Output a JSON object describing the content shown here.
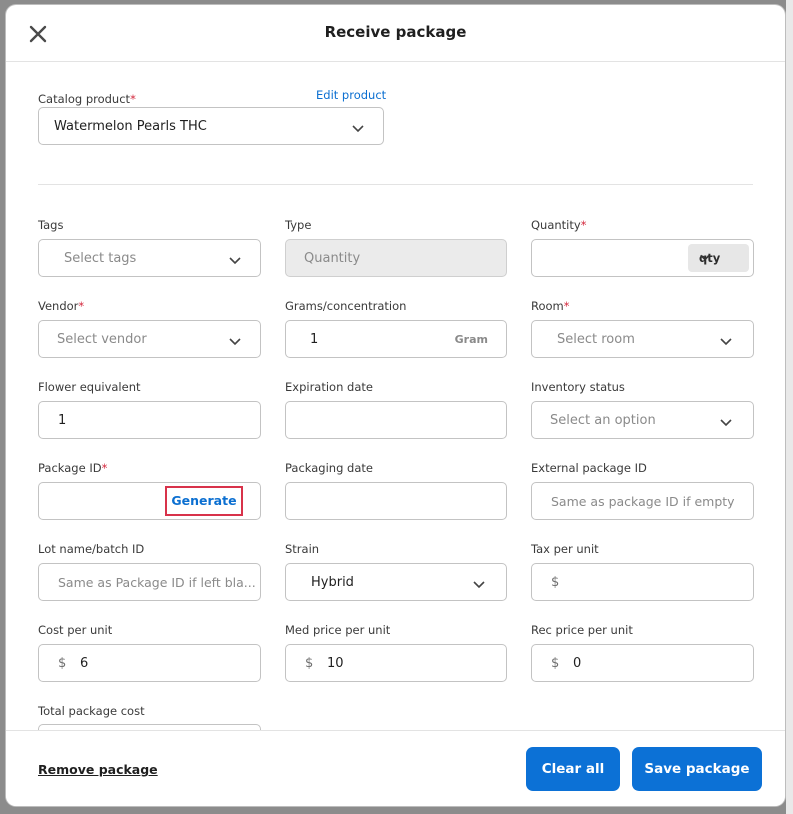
{
  "modal": {
    "title": "Receive package"
  },
  "catalog": {
    "label": "Catalog product",
    "required_mark": "*",
    "edit_link": "Edit product",
    "value": "Watermelon Pearls THC"
  },
  "fields": {
    "tags": {
      "label": "Tags",
      "placeholder": "Select tags"
    },
    "type": {
      "label": "Type",
      "placeholder": "Quantity"
    },
    "quantity": {
      "label": "Quantity",
      "required_mark": "*",
      "unit": "qty"
    },
    "vendor": {
      "label": "Vendor",
      "required_mark": "*",
      "placeholder": "Select vendor"
    },
    "grams": {
      "label": "Grams/concentration",
      "value": "1",
      "suffix": "Gram"
    },
    "room": {
      "label": "Room",
      "required_mark": "*",
      "placeholder": "Select room"
    },
    "flower": {
      "label": "Flower equivalent",
      "value": "1"
    },
    "expiration": {
      "label": "Expiration date",
      "value": ""
    },
    "inventory_status": {
      "label": "Inventory status",
      "placeholder": "Select an option"
    },
    "package_id": {
      "label": "Package ID",
      "required_mark": "*",
      "generate_label": "Generate"
    },
    "packaging_date": {
      "label": "Packaging date",
      "value": ""
    },
    "external_id": {
      "label": "External package ID",
      "placeholder": "Same as package ID if empty"
    },
    "lot": {
      "label": "Lot name/batch ID",
      "placeholder": "Same as Package ID if left bla..."
    },
    "strain": {
      "label": "Strain",
      "value": "Hybrid"
    },
    "tax": {
      "label": "Tax per unit",
      "currency": "$",
      "value": ""
    },
    "cost": {
      "label": "Cost per unit",
      "currency": "$",
      "value": "6"
    },
    "med_price": {
      "label": "Med price per unit",
      "currency": "$",
      "value": "10"
    },
    "rec_price": {
      "label": "Rec price per unit",
      "currency": "$",
      "value": "0"
    },
    "total_cost": {
      "label": "Total package cost"
    }
  },
  "footer": {
    "remove_label": "Remove package",
    "clear_label": "Clear all",
    "save_label": "Save package"
  },
  "colors": {
    "primary": "#0c71d6",
    "required": "#d3273c",
    "highlight_border": "#d8324a"
  }
}
